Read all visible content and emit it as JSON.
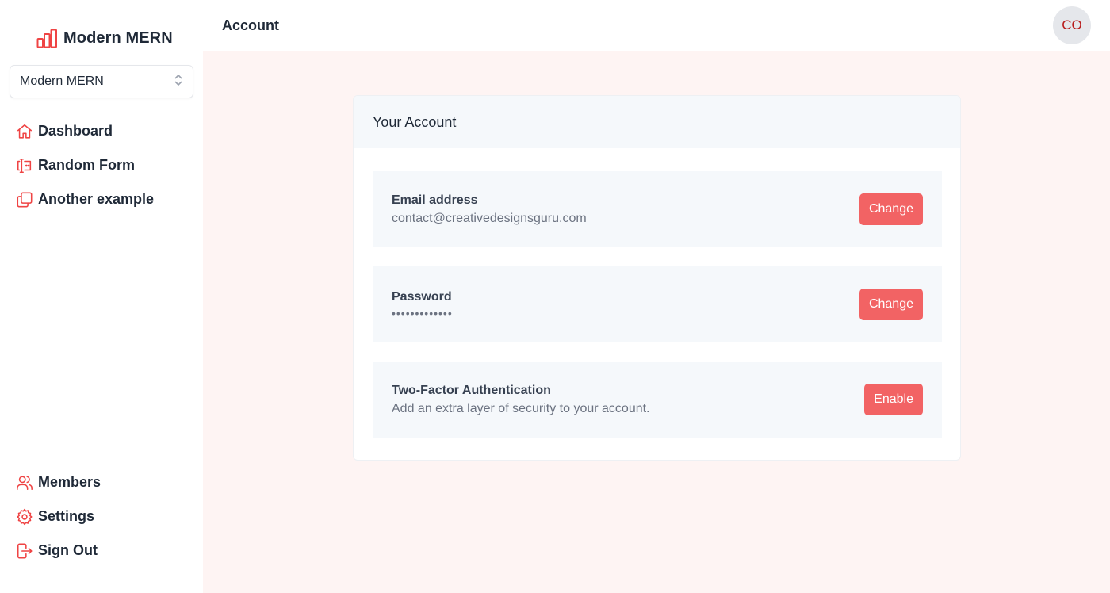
{
  "brand": {
    "name": "Modern MERN",
    "icon": "bar-chart-icon"
  },
  "org_selector": {
    "value": "Modern MERN",
    "icon": "chevron-up-down-icon"
  },
  "nav_top": [
    {
      "label": "Dashboard",
      "icon": "home-icon"
    },
    {
      "label": "Random Form",
      "icon": "form-icon"
    },
    {
      "label": "Another example",
      "icon": "copy-icon"
    }
  ],
  "nav_bottom": [
    {
      "label": "Members",
      "icon": "users-icon"
    },
    {
      "label": "Settings",
      "icon": "gear-icon"
    },
    {
      "label": "Sign Out",
      "icon": "sign-out-icon"
    }
  ],
  "header": {
    "title": "Account",
    "avatar_initials": "CO"
  },
  "account": {
    "title": "Your Account",
    "email": {
      "label": "Email address",
      "value": "contact@creativedesignsguru.com",
      "button": "Change"
    },
    "password": {
      "label": "Password",
      "value": "•••••••••••••",
      "button": "Change"
    },
    "two_factor": {
      "label": "Two-Factor Authentication",
      "description": "Add an extra layer of security to your account.",
      "button": "Enable"
    }
  },
  "colors": {
    "accent": "#f26364",
    "main_bg": "#fef4f3",
    "row_bg": "#f5f8fb",
    "icon": "#ef4444"
  }
}
